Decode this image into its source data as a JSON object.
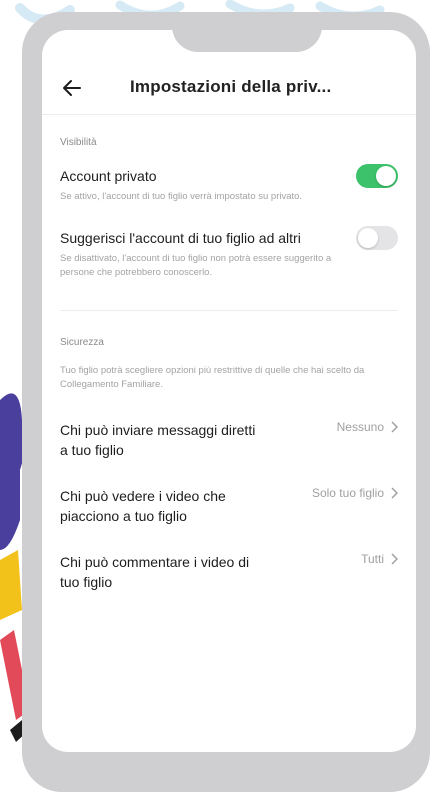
{
  "header": {
    "title": "Impostazioni della priv..."
  },
  "visibility": {
    "section_label": "Visibilità",
    "private_account": {
      "title": "Account privato",
      "description": "Se attivo, l'account di tuo figlio verrà impostato su privato.",
      "enabled": true
    },
    "suggest_account": {
      "title": "Suggerisci l'account di tuo figlio ad altri",
      "description": "Se disattivato, l'account di tuo figlio non potrà essere suggerito a persone che potrebbero conoscerlo.",
      "enabled": false
    }
  },
  "security": {
    "section_label": "Sicurezza",
    "description": "Tuo figlio potrà scegliere opzioni più restrittive di quelle che hai scelto da Collegamento Familiare.",
    "items": [
      {
        "title": "Chi può inviare messaggi diretti a tuo figlio",
        "value": "Nessuno"
      },
      {
        "title": "Chi può vedere i video che piacciono a tuo figlio",
        "value": "Solo tuo figlio"
      },
      {
        "title": "Chi può commentare i video di tuo figlio",
        "value": "Tutti"
      }
    ]
  },
  "colors": {
    "toggle_on": "#3cc26b",
    "toggle_off": "#e4e4e6",
    "frame": "#cfcfd1",
    "deco_blue": "#4a3f9c"
  },
  "icons": {
    "back": "arrow-left-icon",
    "chevron": "chevron-right-icon"
  }
}
